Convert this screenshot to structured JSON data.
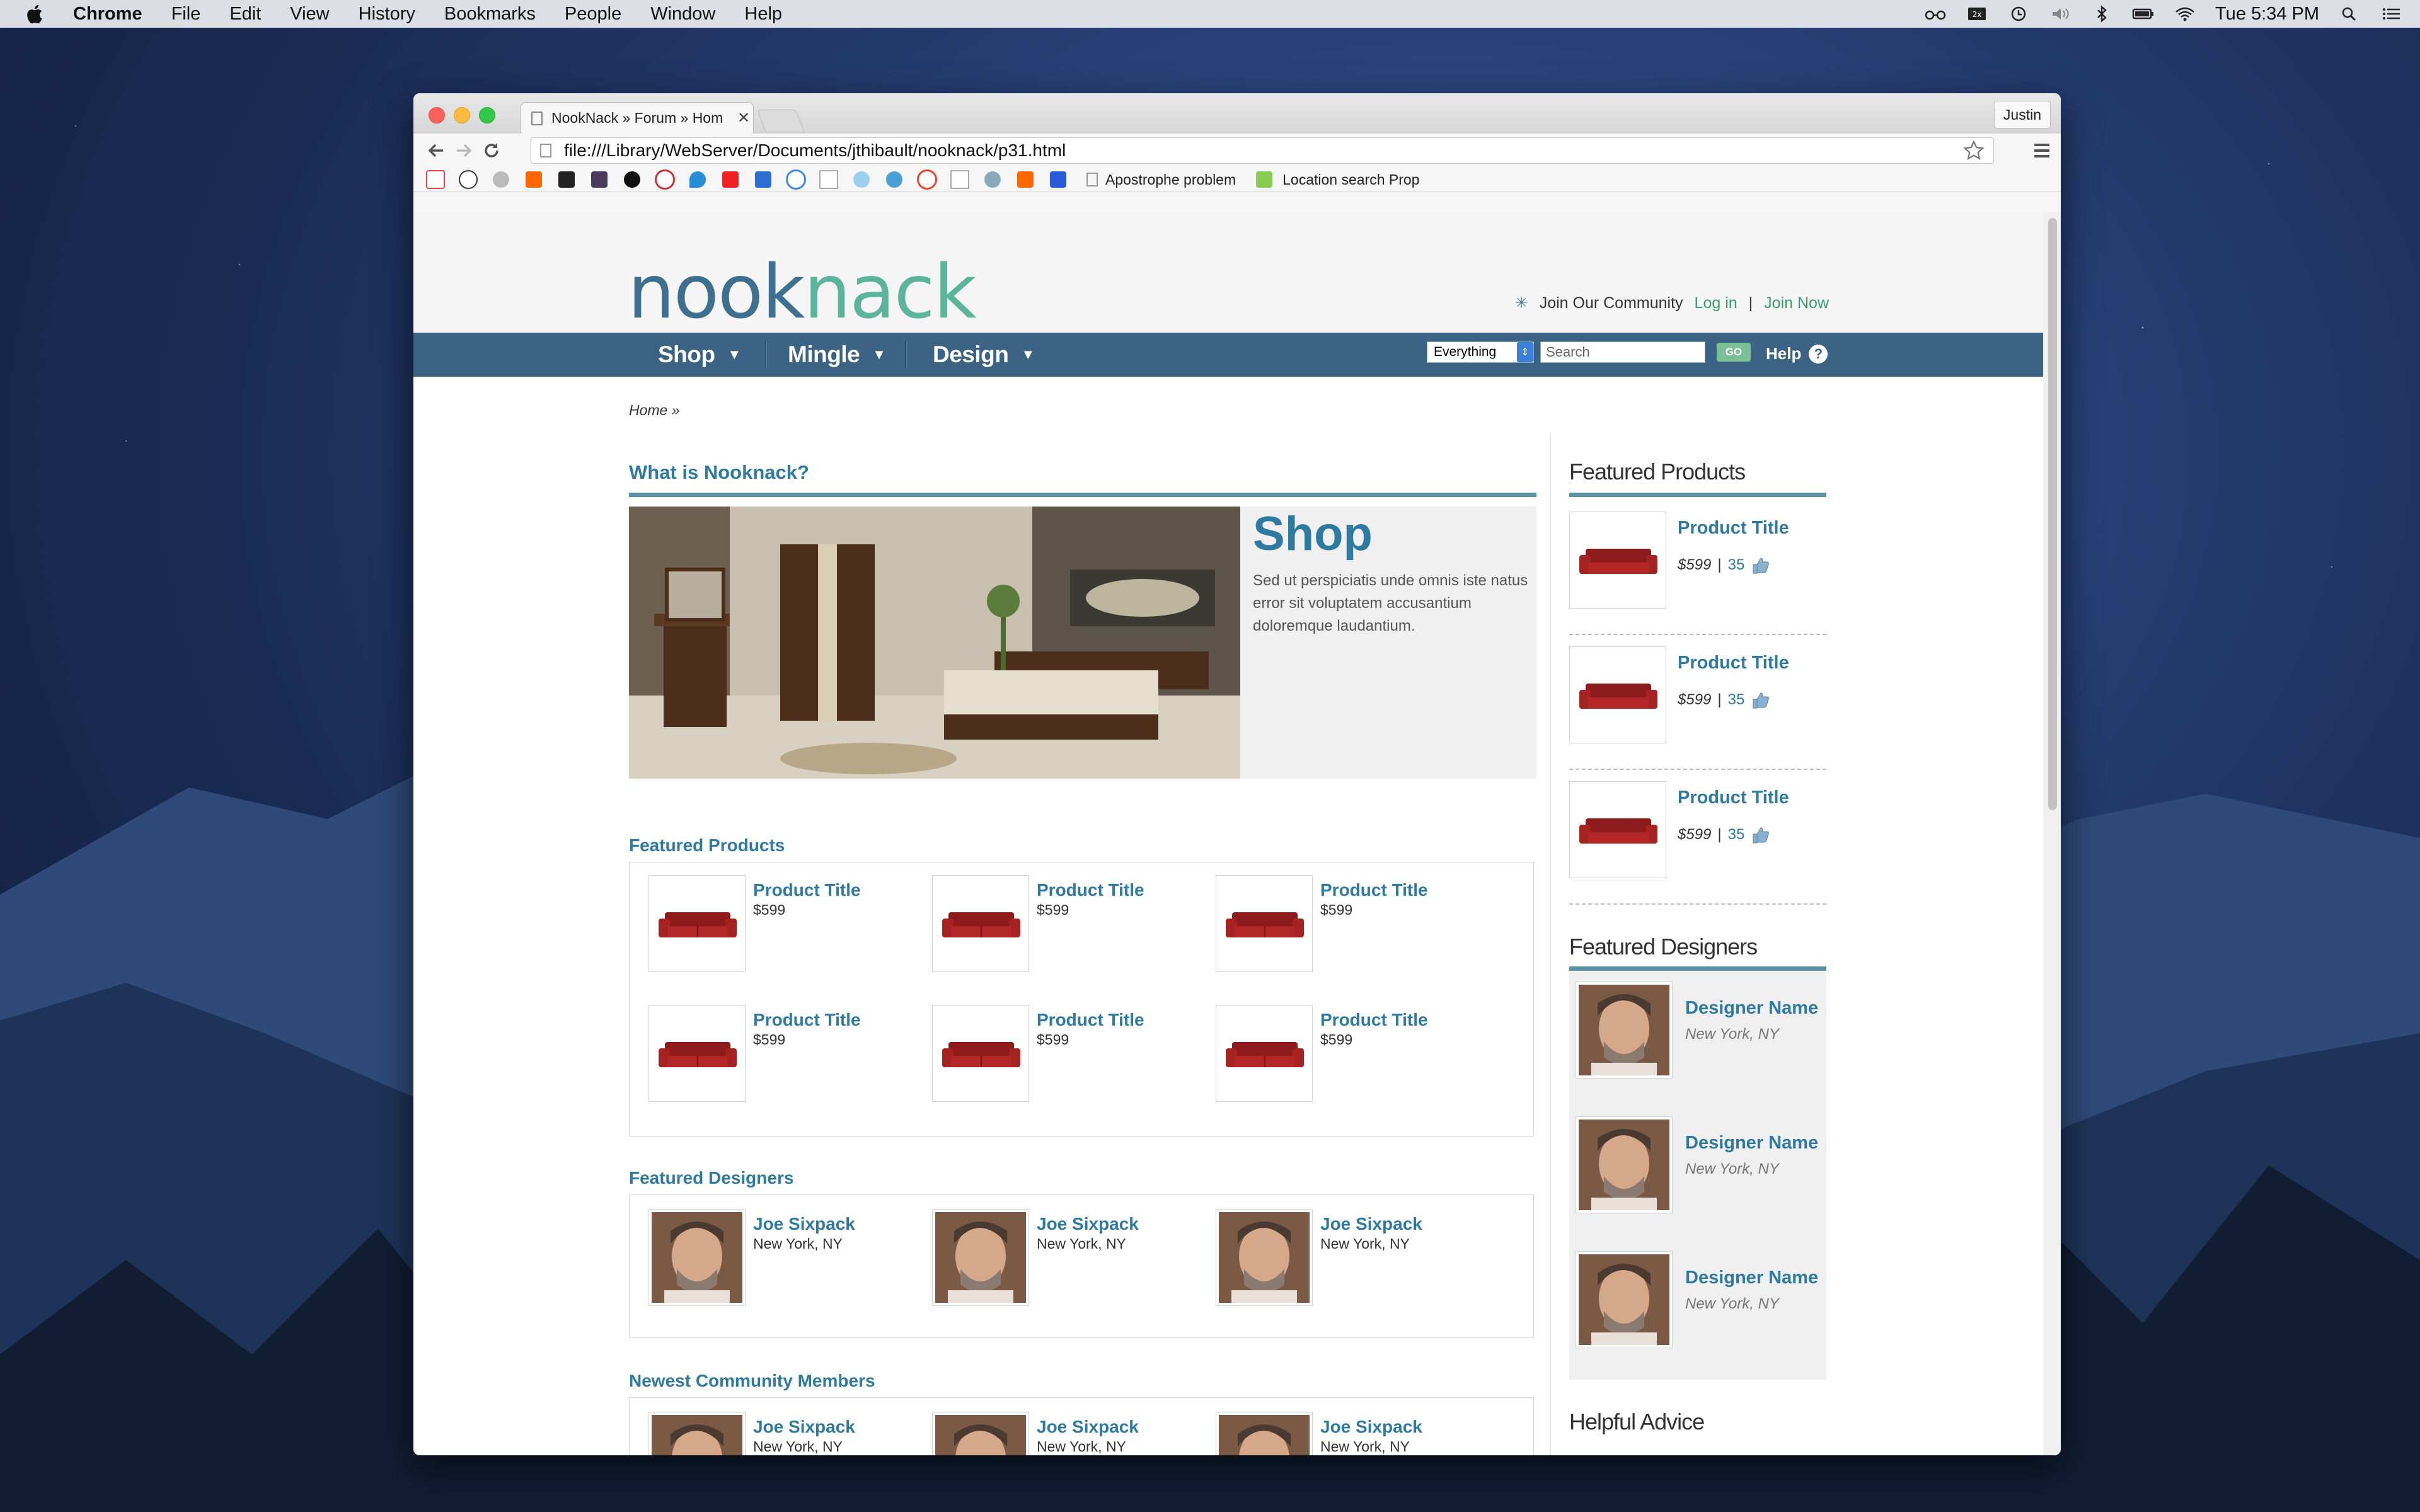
{
  "menubar": {
    "app": "Chrome",
    "items": [
      "File",
      "Edit",
      "View",
      "History",
      "Bookmarks",
      "People",
      "Window",
      "Help"
    ],
    "clock": "Tue 5:34 PM"
  },
  "browser": {
    "tab_title": "NookNack » Forum » Hom",
    "profile": "Justin",
    "url": "file:///Library/WebServer/Documents/jthibault/nooknack/p31.html",
    "bookmarks": [
      {
        "label": "Apostrophe problem"
      },
      {
        "label": "Location search Prop"
      }
    ]
  },
  "site": {
    "logo_part1": "nook",
    "logo_part2": "nack",
    "join_text": "Join Our Community",
    "login": "Log in",
    "join_now": "Join Now",
    "nav": [
      "Shop",
      "Mingle",
      "Design"
    ],
    "search_scope": "Everything",
    "search_placeholder": "Search",
    "go": "GO",
    "help": "Help",
    "breadcrumb": "Home »"
  },
  "hero": {
    "section_title": "What is Nooknack?",
    "title": "Shop",
    "text": "Sed ut perspiciatis unde omnis iste natus error sit voluptatem accusantium doloremque laudantium."
  },
  "featured_products": {
    "title": "Featured Products",
    "items": [
      {
        "title": "Product Title",
        "price": "$599"
      },
      {
        "title": "Product Title",
        "price": "$599"
      },
      {
        "title": "Product Title",
        "price": "$599"
      },
      {
        "title": "Product Title",
        "price": "$599"
      },
      {
        "title": "Product Title",
        "price": "$599"
      },
      {
        "title": "Product Title",
        "price": "$599"
      }
    ]
  },
  "featured_designers": {
    "title": "Featured Designers",
    "items": [
      {
        "name": "Joe Sixpack",
        "location": "New York, NY"
      },
      {
        "name": "Joe Sixpack",
        "location": "New York, NY"
      },
      {
        "name": "Joe Sixpack",
        "location": "New York, NY"
      }
    ]
  },
  "newest_members": {
    "title": "Newest Community Members",
    "items": [
      {
        "name": "Joe Sixpack",
        "location": "New York, NY"
      },
      {
        "name": "Joe Sixpack",
        "location": "New York, NY"
      },
      {
        "name": "Joe Sixpack",
        "location": "New York, NY"
      }
    ]
  },
  "sidebar": {
    "products_title": "Featured Products",
    "products": [
      {
        "title": "Product Title",
        "price": "$599",
        "count": "35"
      },
      {
        "title": "Product Title",
        "price": "$599",
        "count": "35"
      },
      {
        "title": "Product Title",
        "price": "$599",
        "count": "35"
      }
    ],
    "designers_title": "Featured Designers",
    "designers": [
      {
        "name": "Designer Name",
        "location": "New York, NY"
      },
      {
        "name": "Designer Name",
        "location": "New York, NY"
      },
      {
        "name": "Designer Name",
        "location": "New York, NY"
      }
    ],
    "advice_title": "Helpful Advice"
  },
  "icons": {
    "apple": "apple-logo-icon",
    "back": "back-arrow-icon",
    "forward": "forward-arrow-icon",
    "reload": "reload-icon",
    "star": "bookmark-star-icon",
    "menu": "hamburger-menu-icon",
    "thumb": "thumbs-up-icon"
  },
  "colors": {
    "nav_bg": "#3c6383",
    "link_blue": "#2f7aa0",
    "link_green": "#3a9c6d",
    "accent_rule": "#5a8fa5"
  }
}
